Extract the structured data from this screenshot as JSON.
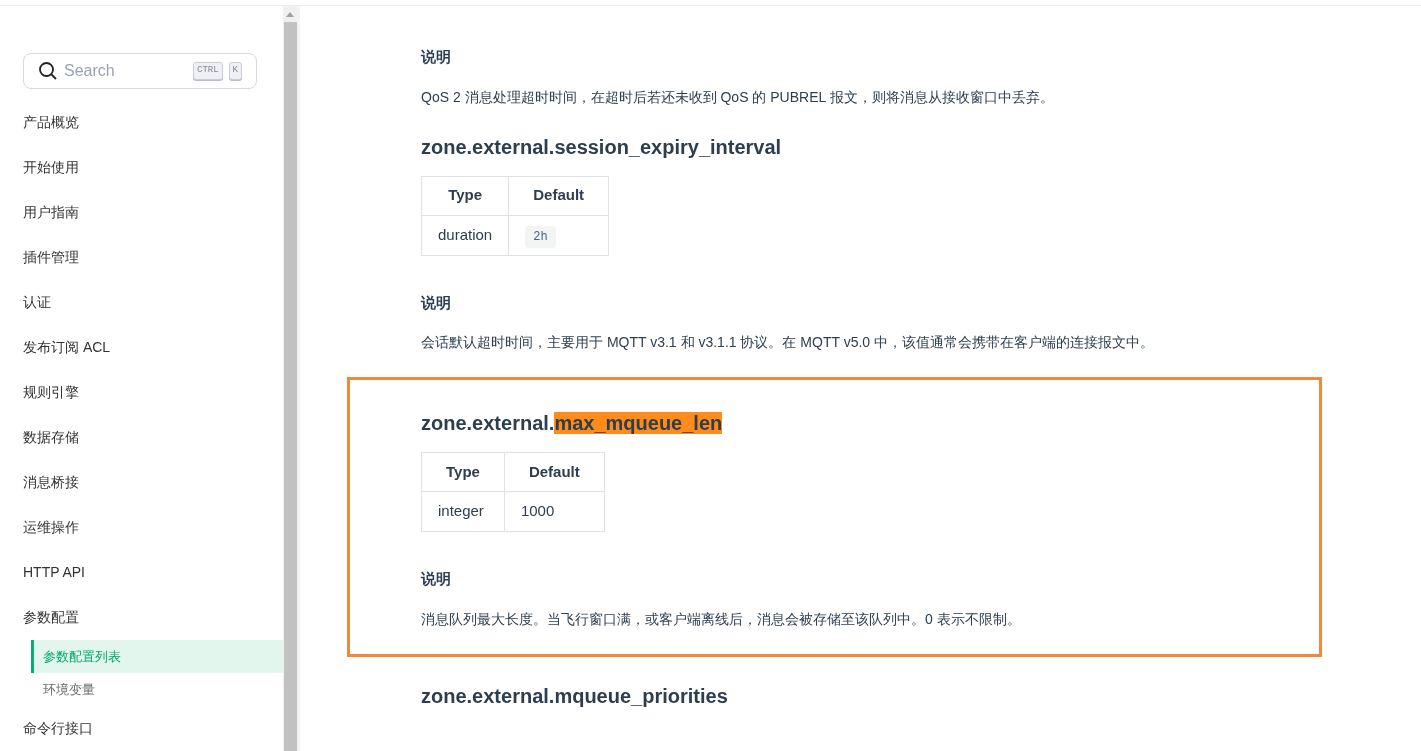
{
  "sidebar": {
    "search": {
      "placeholder": "Search",
      "keys": [
        "CTRL",
        "K"
      ]
    },
    "items": [
      {
        "label": "产品概览",
        "selected": false
      },
      {
        "label": "开始使用",
        "selected": false
      },
      {
        "label": "用户指南",
        "selected": false
      },
      {
        "label": "插件管理",
        "selected": false
      },
      {
        "label": "认证",
        "selected": false
      },
      {
        "label": "发布订阅 ACL",
        "selected": false
      },
      {
        "label": "规则引擎",
        "selected": false
      },
      {
        "label": "数据存储",
        "selected": false
      },
      {
        "label": "消息桥接",
        "selected": false
      },
      {
        "label": "运维操作",
        "selected": false
      },
      {
        "label": "HTTP API",
        "selected": false
      },
      {
        "label": "参数配置",
        "selected": false,
        "children": [
          {
            "label": "参数配置列表",
            "selected": true
          },
          {
            "label": "环境变量",
            "selected": false
          }
        ]
      },
      {
        "label": "命令行接口",
        "selected": false
      }
    ]
  },
  "sections": [
    {
      "boxed": false,
      "note_label": "说明",
      "description": "QoS 2 消息处理超时时间，在超时后若还未收到 QoS 的 PUBREL 报文，则将消息从接收窗口中丢弃。"
    },
    {
      "boxed": false,
      "title_parts": [
        {
          "text": "zone.external.session_expiry_interval",
          "highlighted": false
        }
      ],
      "table": {
        "columns": [
          "Type",
          "Default"
        ],
        "row": [
          {
            "kind": "text",
            "text": "duration"
          },
          {
            "kind": "code",
            "text": "2h"
          }
        ]
      },
      "note_label": "说明",
      "description": "会话默认超时时间，主要用于 MQTT v3.1 和 v3.1.1 协议。在 MQTT v5.0 中，该值通常会携带在客户端的连接报文中。"
    },
    {
      "boxed": true,
      "title_parts": [
        {
          "text": "zone.external.",
          "highlighted": false
        },
        {
          "text": "max_mqueue_len",
          "highlighted": true
        }
      ],
      "table": {
        "columns": [
          "Type",
          "Default"
        ],
        "row": [
          {
            "kind": "text",
            "text": "integer"
          },
          {
            "kind": "text",
            "text": "1000"
          }
        ]
      },
      "note_label": "说明",
      "description": "消息队列最大长度。当飞行窗口满，或客户端离线后，消息会被存储至该队列中。0 表示不限制。"
    },
    {
      "boxed": false,
      "title_parts": [
        {
          "text": "zone.external.mqueue_priorities",
          "highlighted": false
        }
      ]
    }
  ]
}
